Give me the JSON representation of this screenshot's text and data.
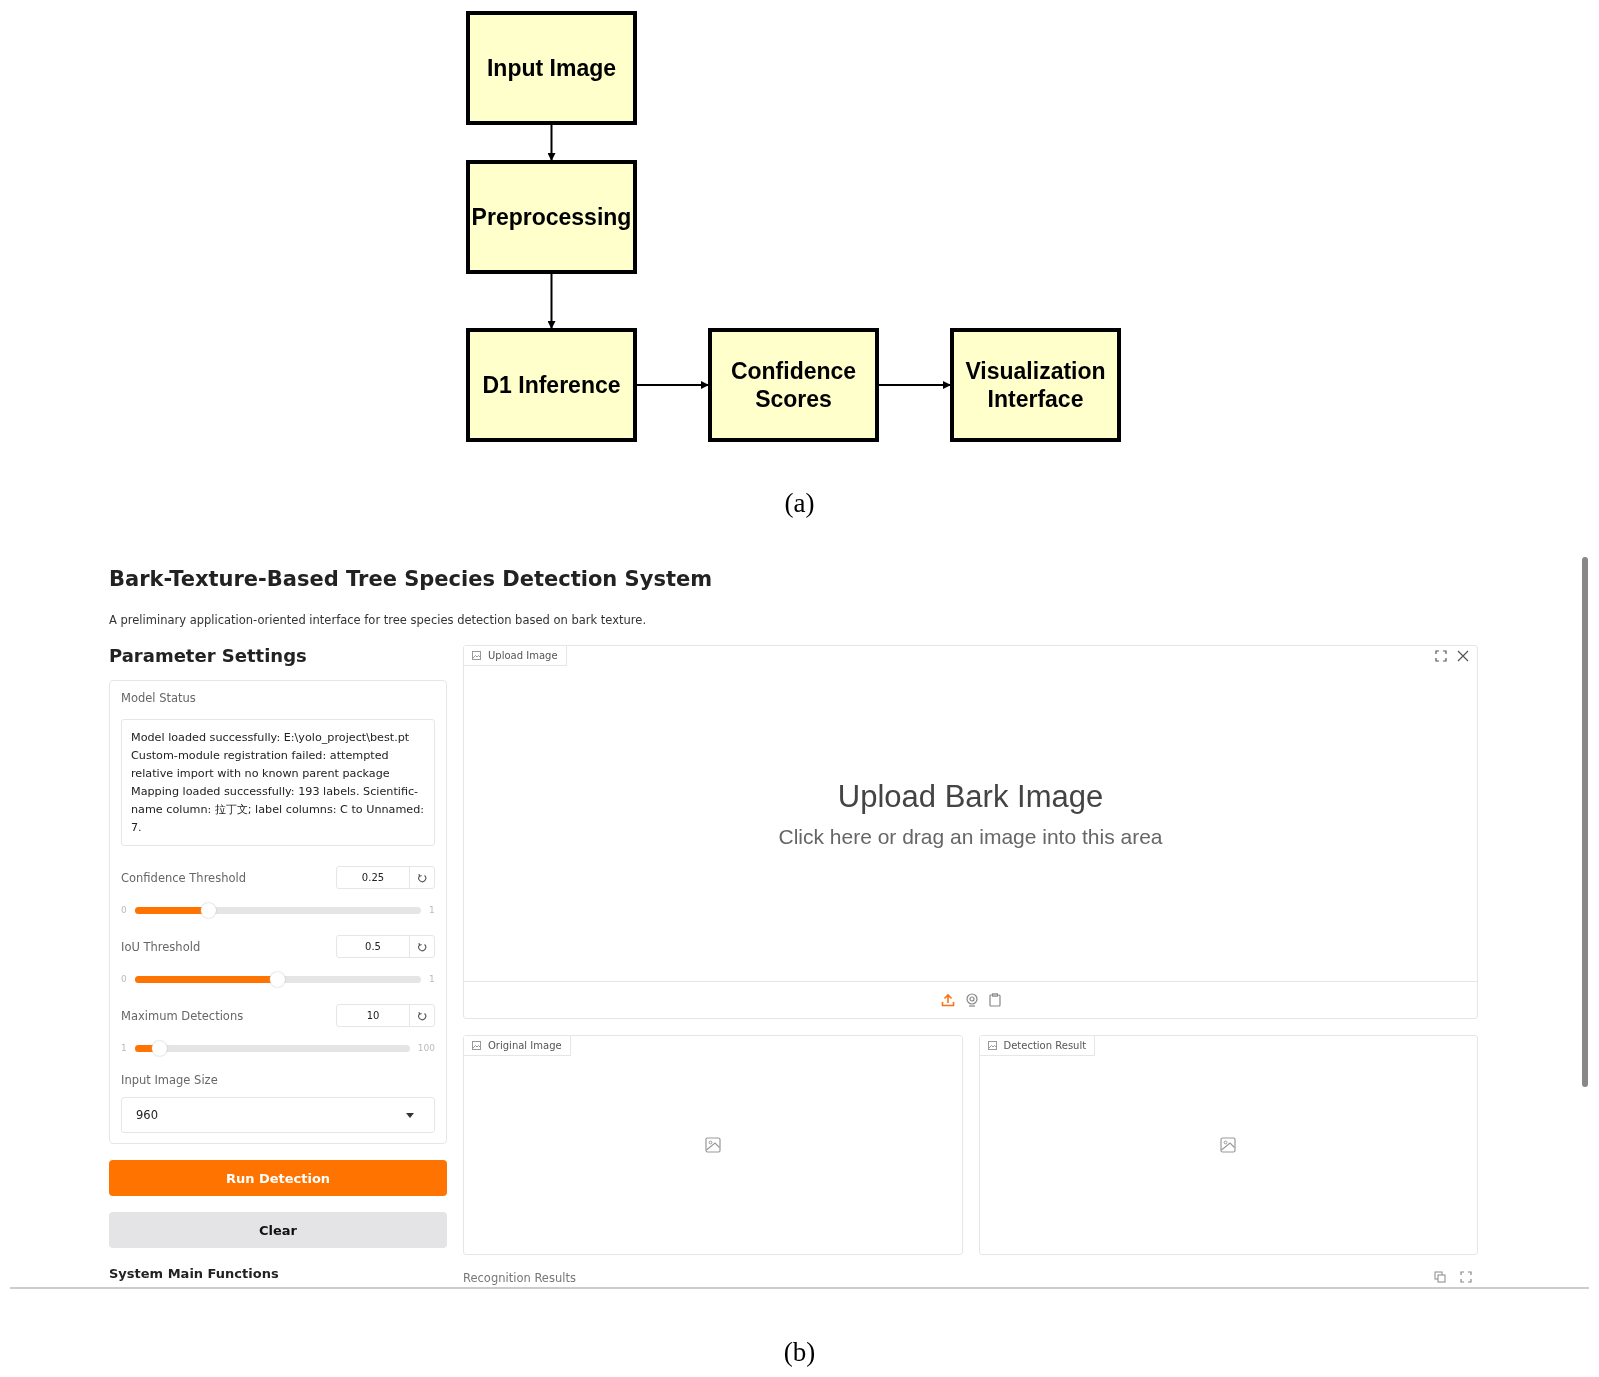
{
  "figure_a": {
    "nodes": [
      {
        "lines": [
          "Input Image"
        ]
      },
      {
        "lines": [
          "Preprocessing"
        ]
      },
      {
        "lines": [
          "D1 Inference"
        ]
      },
      {
        "lines": [
          "Confidence",
          "Scores"
        ]
      },
      {
        "lines": [
          "Visualization",
          "Interface"
        ]
      }
    ],
    "caption": "(a)"
  },
  "app": {
    "title": "Bark-Texture-Based Tree Species Detection System",
    "description": "A preliminary application-oriented interface for tree species detection based on bark texture.",
    "settings_title": "Parameter Settings",
    "model_status": {
      "label": "Model Status",
      "lines": [
        "Model loaded successfully: E:\\yolo_project\\best.pt",
        "Custom-module registration failed: attempted relative import with no known parent package",
        "Mapping loaded successfully: 193 labels. Scientific-name column: 拉丁文; label columns: C to Unnamed: 7."
      ]
    },
    "sliders": [
      {
        "label": "Confidence Threshold",
        "value": "0.25",
        "min": "0",
        "max": "1",
        "level": 0.26
      },
      {
        "label": "IoU Threshold",
        "value": "0.5",
        "min": "0",
        "max": "1",
        "level": 0.5
      },
      {
        "label": "Maximum Detections",
        "value": "10",
        "min": "1",
        "max": "100",
        "level": 0.09
      }
    ],
    "image_size": {
      "label": "Input Image Size",
      "value": "960"
    },
    "buttons": [
      {
        "label": "Run Detection",
        "kind": "primary"
      },
      {
        "label": "Clear",
        "kind": "secondary"
      }
    ],
    "functions_heading": "System Main Functions",
    "upload": {
      "tab": "Upload Image",
      "title": "Upload Bark Image",
      "hint": "Click here or drag an image into this area"
    },
    "outputs": [
      {
        "tab": "Original Image"
      },
      {
        "tab": "Detection Result"
      }
    ],
    "results_label": "Recognition Results"
  },
  "caption_b": "(b)"
}
